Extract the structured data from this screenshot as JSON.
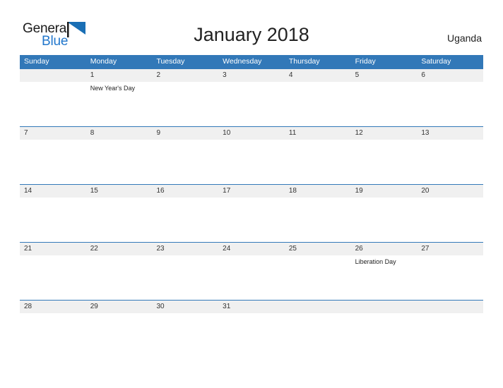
{
  "branding": {
    "logo_word_1": "General",
    "logo_word_2": "Blue",
    "logo_flag_icon": "blue-flag-triangle-icon",
    "logo_color_dark": "#1a1a1a",
    "logo_color_blue": "#2277cc"
  },
  "header": {
    "title": "January 2018",
    "country": "Uganda"
  },
  "theme": {
    "header_blue": "#3278b8",
    "row_line_blue": "#3278b8",
    "date_band_gray": "#f0f0f0",
    "text_dark": "#222222",
    "page_background": "#ffffff"
  },
  "calendar": {
    "month": "January",
    "year": "2018",
    "weekday_headers": [
      "Sunday",
      "Monday",
      "Tuesday",
      "Wednesday",
      "Thursday",
      "Friday",
      "Saturday"
    ],
    "weeks": [
      {
        "days": [
          {
            "date": "",
            "event": ""
          },
          {
            "date": "1",
            "event": "New Year's Day"
          },
          {
            "date": "2",
            "event": ""
          },
          {
            "date": "3",
            "event": ""
          },
          {
            "date": "4",
            "event": ""
          },
          {
            "date": "5",
            "event": ""
          },
          {
            "date": "6",
            "event": ""
          }
        ]
      },
      {
        "days": [
          {
            "date": "7",
            "event": ""
          },
          {
            "date": "8",
            "event": ""
          },
          {
            "date": "9",
            "event": ""
          },
          {
            "date": "10",
            "event": ""
          },
          {
            "date": "11",
            "event": ""
          },
          {
            "date": "12",
            "event": ""
          },
          {
            "date": "13",
            "event": ""
          }
        ]
      },
      {
        "days": [
          {
            "date": "14",
            "event": ""
          },
          {
            "date": "15",
            "event": ""
          },
          {
            "date": "16",
            "event": ""
          },
          {
            "date": "17",
            "event": ""
          },
          {
            "date": "18",
            "event": ""
          },
          {
            "date": "19",
            "event": ""
          },
          {
            "date": "20",
            "event": ""
          }
        ]
      },
      {
        "days": [
          {
            "date": "21",
            "event": ""
          },
          {
            "date": "22",
            "event": ""
          },
          {
            "date": "23",
            "event": ""
          },
          {
            "date": "24",
            "event": ""
          },
          {
            "date": "25",
            "event": ""
          },
          {
            "date": "26",
            "event": "Liberation Day"
          },
          {
            "date": "27",
            "event": ""
          }
        ]
      },
      {
        "days": [
          {
            "date": "28",
            "event": ""
          },
          {
            "date": "29",
            "event": ""
          },
          {
            "date": "30",
            "event": ""
          },
          {
            "date": "31",
            "event": ""
          },
          {
            "date": "",
            "event": ""
          },
          {
            "date": "",
            "event": ""
          },
          {
            "date": "",
            "event": ""
          }
        ]
      }
    ]
  }
}
